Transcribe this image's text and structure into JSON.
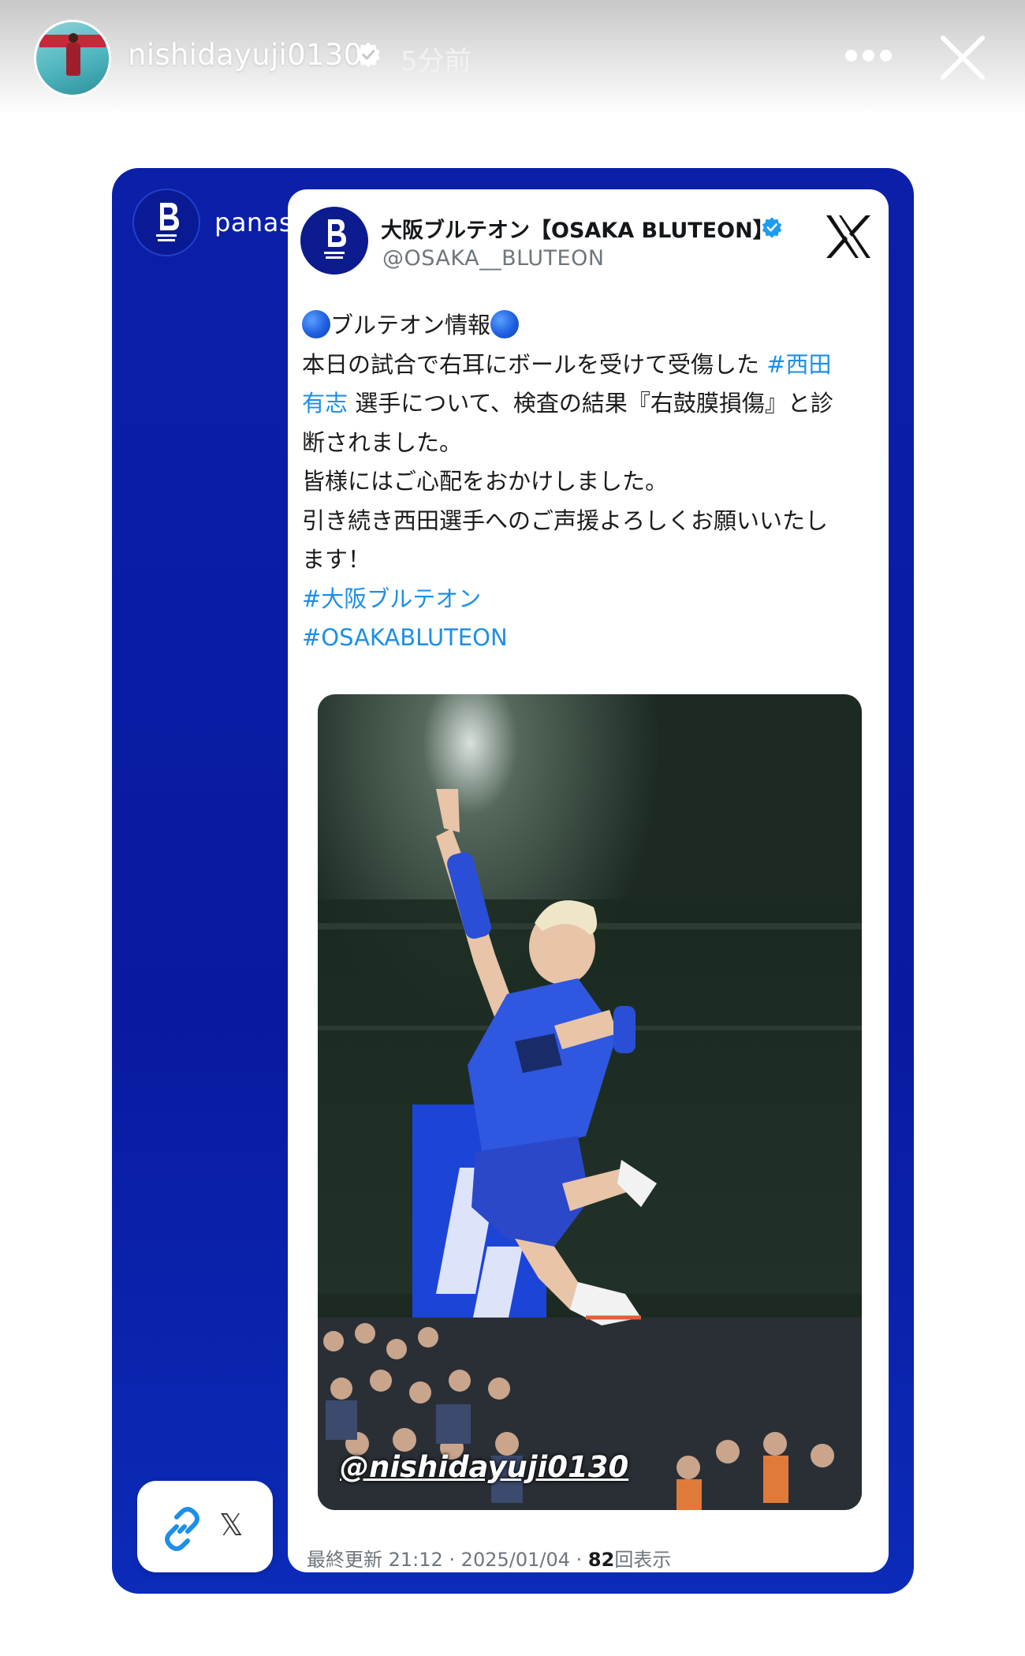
{
  "header": {
    "username": "nishidayuji0130",
    "time_ago": "5分前",
    "verified": true,
    "icons": [
      "more-icon",
      "close-icon"
    ]
  },
  "shared_post": {
    "handle": "panasonic_panthers",
    "background_color": "#0b1fa8"
  },
  "tweet": {
    "display_name": "大阪ブルテオン【OSAKA BLUTEON】",
    "handle": "@OSAKA__BLUTEON",
    "lines": {
      "title": "ブルテオン情報",
      "line1_prefix": "本日の試合で右耳にボールを受けて受傷した ",
      "line1_tag": "#西田",
      "line2_tag": "有志",
      "line2_rest": " 選手について、検査の結果『右鼓膜損傷』と診",
      "line3": "断されました。",
      "line4": "皆様にはご心配をおかけしました。",
      "line5": "引き続き西田選手へのご声援よろしくお願いいたし",
      "line6": "ます！",
      "hashtag1": "#大阪ブルテオン",
      "hashtag2": "#OSAKABLUTEON"
    },
    "photo_credit": "@nishidayuji0130",
    "meta": {
      "prefix": "最終更新 21:12 · 2025/01/04 · ",
      "views_count": "82",
      "views_label": "回表示"
    },
    "hashtag_color": "#1d8fe8"
  },
  "link_sticker": {
    "label": "𝕏"
  }
}
